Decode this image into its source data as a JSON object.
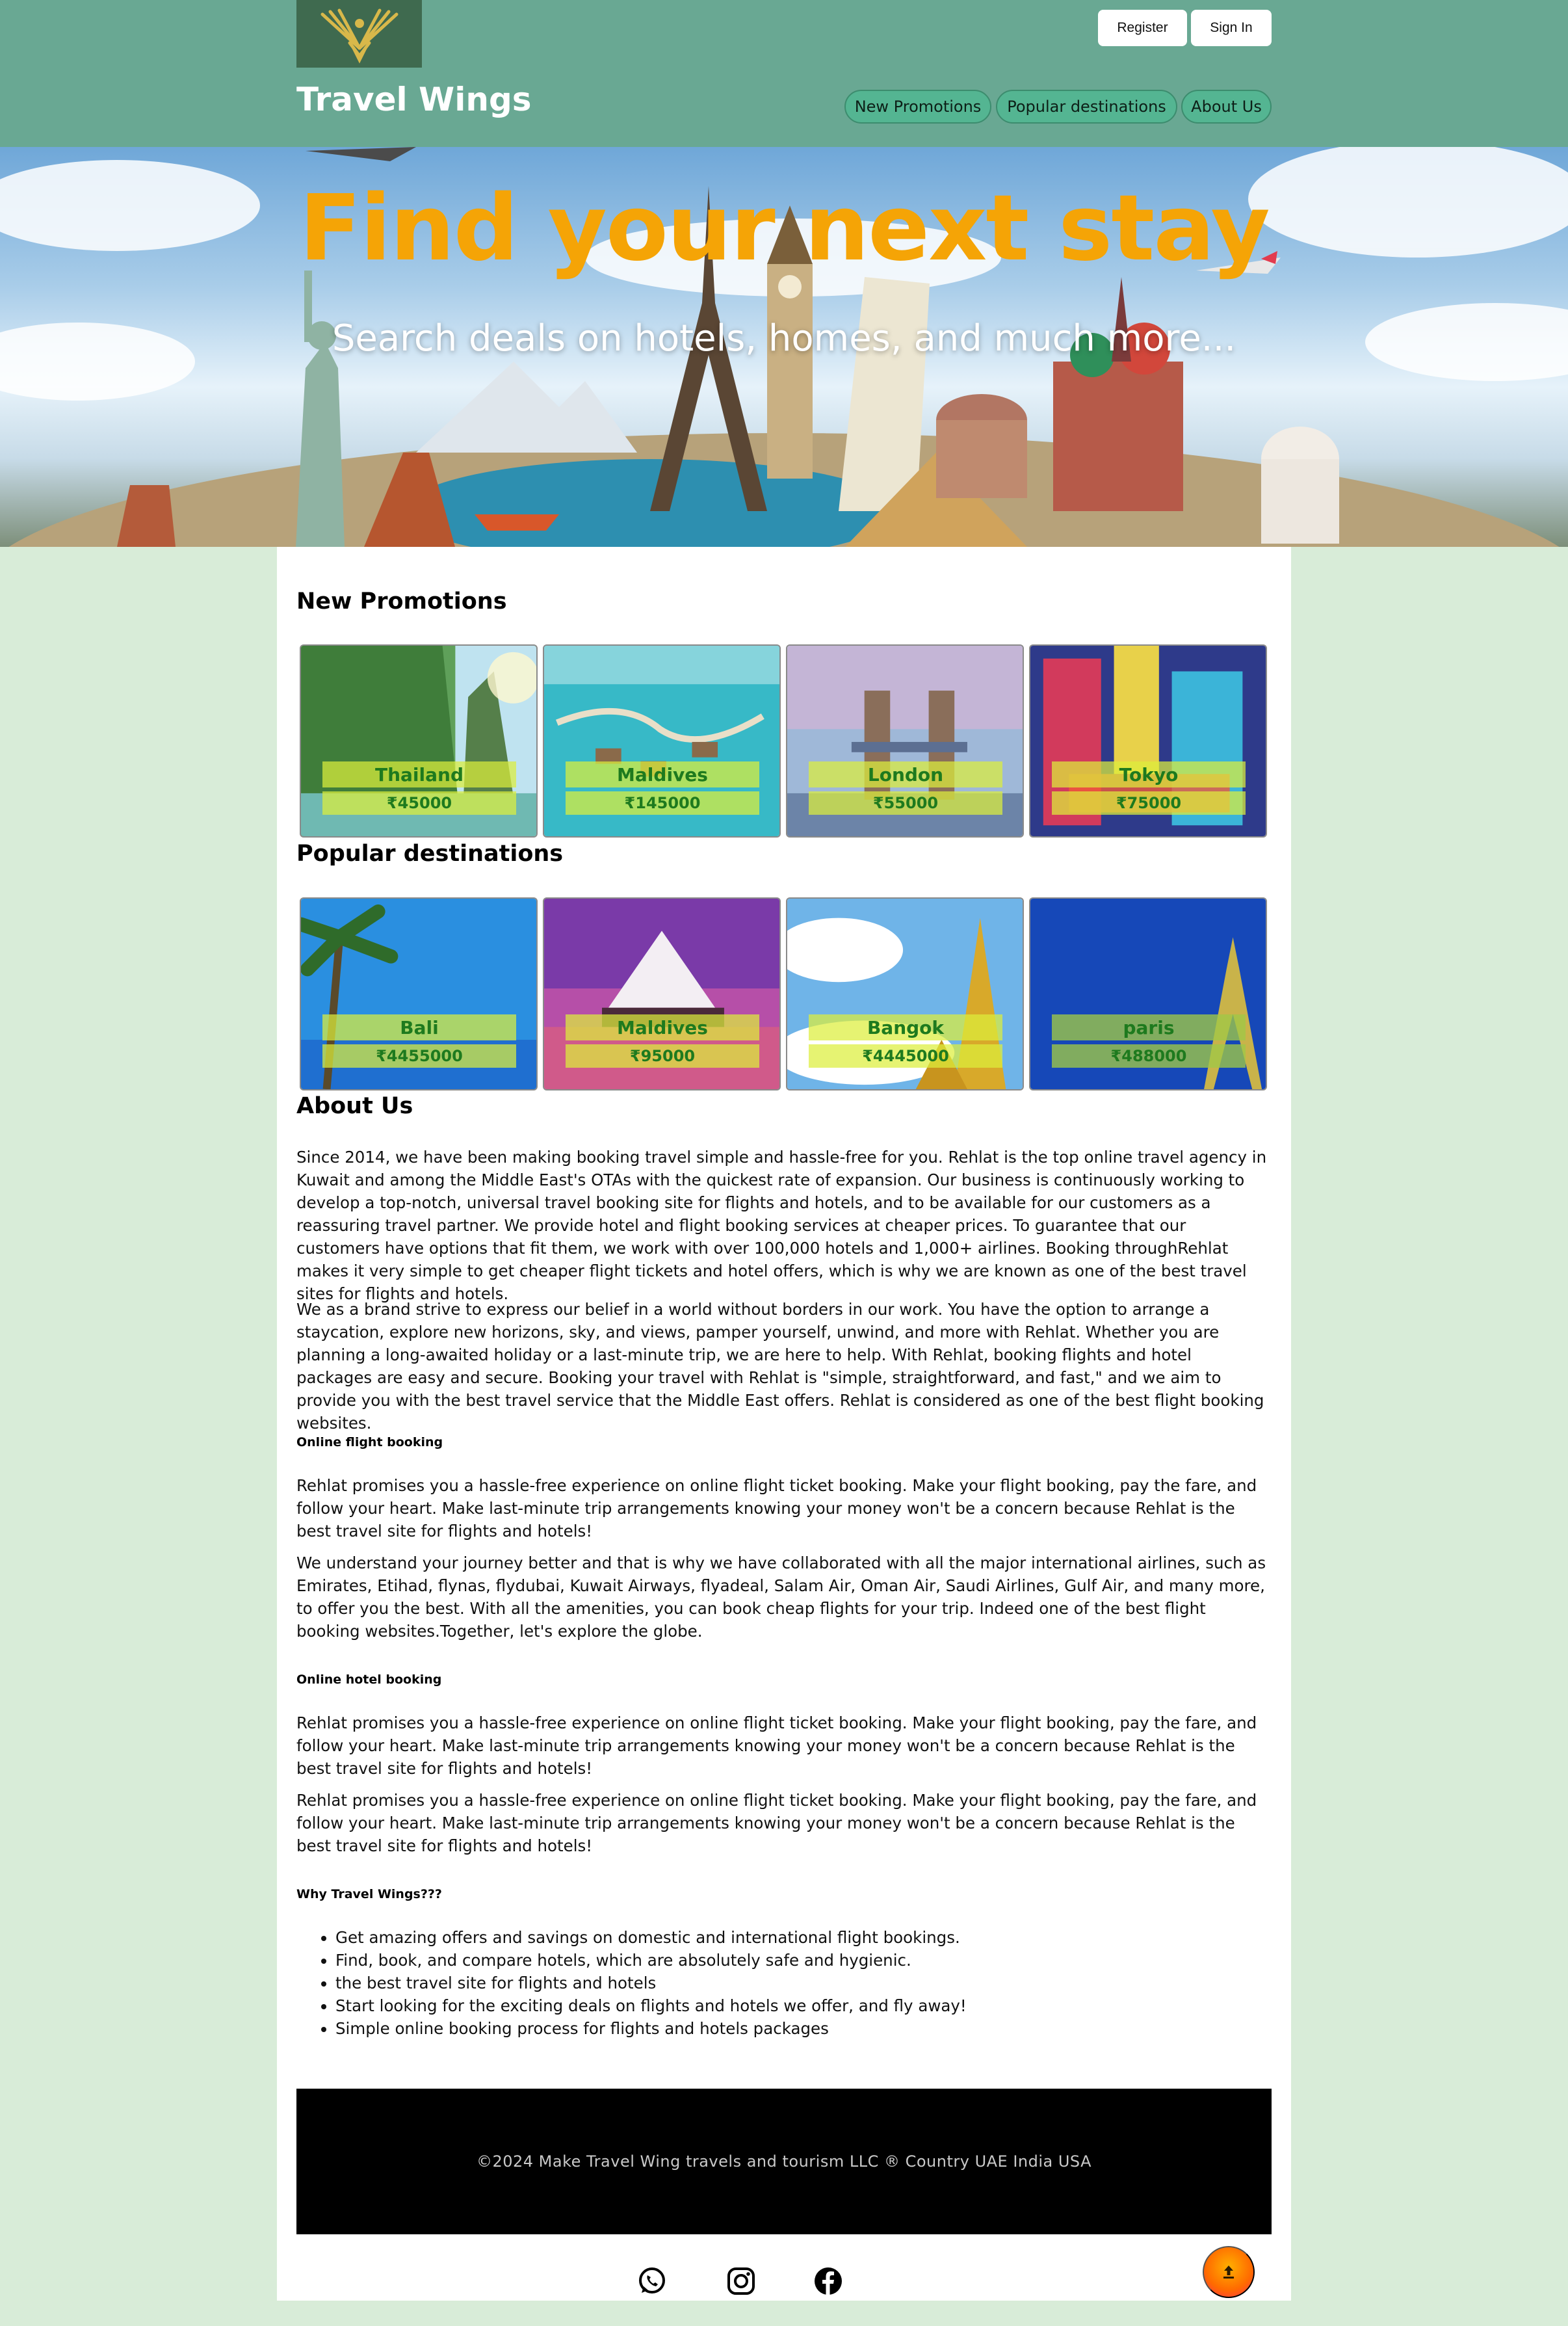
{
  "header": {
    "brand": "Travel Wings",
    "auth": {
      "register": "Register",
      "sign_in": "Sign In"
    },
    "nav": [
      "New Promotions",
      "Popular destinations",
      "About Us"
    ]
  },
  "hero": {
    "title": "Find your next stay",
    "subtitle": "Search deals on hotels, homes, and much more..."
  },
  "promotions": {
    "title": "New Promotions",
    "cards": [
      {
        "name": "Thailand",
        "price": "₹45000",
        "image": "thailand-cliffs"
      },
      {
        "name": "Maldives",
        "price": "₹145000",
        "image": "maldives-water-villas"
      },
      {
        "name": "London",
        "price": "₹55000",
        "image": "london-tower-bridge"
      },
      {
        "name": "Tokyo",
        "price": "₹75000",
        "image": "tokyo-neon-street"
      }
    ]
  },
  "popular": {
    "title": "Popular destinations",
    "cards": [
      {
        "name": "Bali",
        "price": "₹4455000",
        "image": "bali-palms"
      },
      {
        "name": "Maldives",
        "price": "₹95000",
        "image": "maldives-sunset-pavilion"
      },
      {
        "name": "Bangok",
        "price": "₹4445000",
        "image": "bangkok-golden-temple"
      },
      {
        "name": "paris",
        "price": "₹488000",
        "image": "paris-eiffel-tower"
      }
    ]
  },
  "about": {
    "title": "About Us",
    "p1": "Since 2014, we have been making booking travel simple and hassle-free for you. Rehlat is the top online travel agency in Kuwait and among the Middle East's OTAs with the quickest rate of expansion. Our business is continuously working to develop a top-notch, universal travel booking site for flights and hotels, and to be available for our customers as a reassuring travel partner. We provide hotel and flight booking services at cheaper prices. To guarantee that our customers have options that fit them, we work with over 100,000 hotels and 1,000+ airlines. Booking throughRehlat makes it very simple to get cheaper flight tickets and hotel offers, which is why we are known as one of the best travel sites for flights and hotels.",
    "p2": "We as a brand strive to express our belief in a world without borders in our work. You have the option to arrange a staycation, explore new horizons, sky, and views, pamper yourself, unwind, and more with Rehlat. Whether you are planning a long-awaited holiday or a last-minute trip, we are here to help. With Rehlat, booking flights and hotel packages are easy and secure. Booking your travel with Rehlat is \"simple, straightforward, and fast,\" and we aim to provide you with the best travel service that the Middle East offers. Rehlat is considered as one of the best flight booking websites.",
    "h_flight": "Online flight booking",
    "p3": "Rehlat promises you a hassle-free experience on online flight ticket booking. Make your flight booking, pay the fare, and follow your heart. Make last-minute trip arrangements knowing your money won't be a concern because Rehlat is the best travel site for flights and hotels!",
    "p4": "We understand your journey better and that is why we have collaborated with all the major international airlines, such as Emirates, Etihad, flynas, flydubai, Kuwait Airways, flyadeal, Salam Air, Oman Air, Saudi Airlines, Gulf Air, and many more, to offer you the best. With all the amenities, you can book cheap flights for your trip. Indeed one of the best flight booking websites.Together, let's explore the globe.",
    "h_hotel": "Online hotel booking",
    "p5": "Rehlat promises you a hassle-free experience on online flight ticket booking. Make your flight booking, pay the fare, and follow your heart. Make last-minute trip arrangements knowing your money won't be a concern because Rehlat is the best travel site for flights and hotels!",
    "p6": "Rehlat promises you a hassle-free experience on online flight ticket booking. Make your flight booking, pay the fare, and follow your heart. Make last-minute trip arrangements knowing your money won't be a concern because Rehlat is the best travel site for flights and hotels!",
    "h_why": "Why Travel Wings???",
    "why": [
      "Get amazing offers and savings on domestic and international flight bookings.",
      "Find, book, and compare hotels, which are absolutely safe and hygienic.",
      "the best travel site for flights and hotels",
      "Start looking for the exciting deals on flights and hotels we offer, and fly away!",
      "Simple online booking process for flights and hotels packages"
    ]
  },
  "footer": {
    "copyright": "©2024 Make Travel Wing travels and tourism LLC ® Country UAE India USA",
    "social": [
      "whatsapp-icon",
      "instagram-icon",
      "facebook-icon"
    ],
    "scroll_top": "arrow-up-icon"
  },
  "colors": {
    "header_bg": "#69a893",
    "page_bg": "#d8ecd8",
    "hero_title": "#f5a406",
    "nav_pill": "#54b592",
    "card_label_bg": "#dcee3c",
    "card_label_text": "#1e7a1e"
  }
}
